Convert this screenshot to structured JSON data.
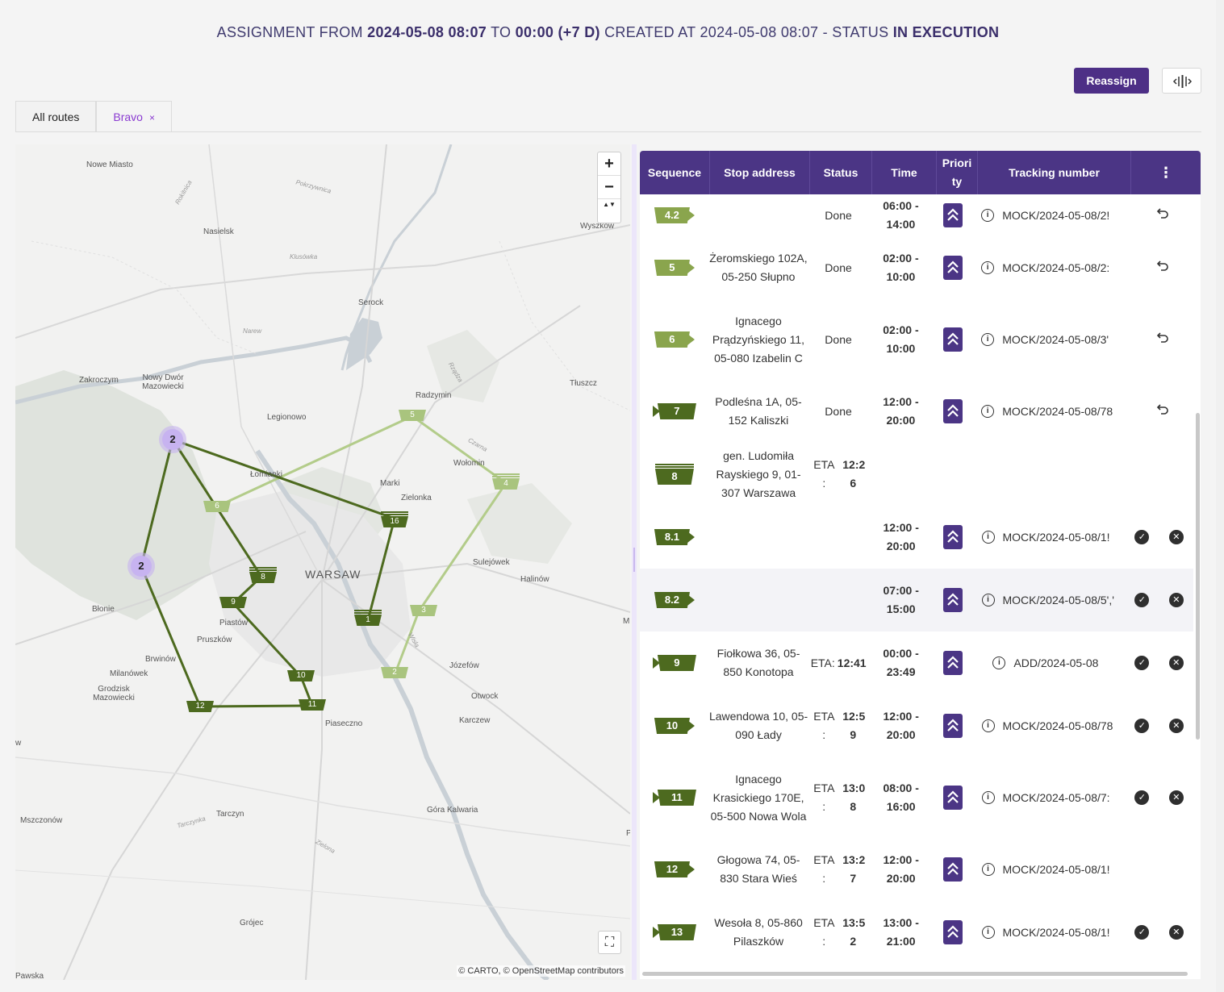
{
  "header": {
    "prefix": "ASSIGNMENT FROM",
    "from": "2024-05-08 08:07",
    "to_word": "TO",
    "to": "00:00 (+7 D)",
    "created_word": "CREATED AT 2024-05-08 08:07 - STATUS",
    "status": "IN EXECUTION"
  },
  "toolbar": {
    "reassign_label": "Reassign",
    "split_icon": "split-columns-icon"
  },
  "tabs": [
    {
      "label": "All routes"
    },
    {
      "label": "Bravo",
      "close": "×"
    }
  ],
  "map": {
    "zoom_in": "+",
    "zoom_out": "−",
    "compass": "▲▼",
    "fullscreen": "⛶",
    "attribution": "© CARTO, © OpenStreetMap contributors",
    "city_label": "WARSAW",
    "places": [
      "Nowe Miasto",
      "Nasielsk",
      "Wyszków",
      "Serock",
      "Zakroczym",
      "Nowy Dwór Mazowiecki",
      "Tłuszcz",
      "Radzymin",
      "Legionowo",
      "Łomianki",
      "Marki",
      "Wołomin",
      "Zielonka",
      "Sulejówek",
      "Halinów",
      "Błonie",
      "Piastów",
      "Pruszków",
      "Brwinów",
      "Milanówek",
      "Grodzisk Mazowiecki",
      "Józefów",
      "Otwock",
      "Karczew",
      "Piaseczno",
      "Tarczyn",
      "Mszczonów",
      "Góra Kalwaria",
      "Grójec",
      "Pawska",
      "M",
      "P",
      "w"
    ],
    "rivers": [
      "Pokrzywnica",
      "Klusówka",
      "Narew",
      "Rządza",
      "Czarna",
      "Wisła",
      "Tarczynka",
      "Zielona",
      "Rokitnica"
    ],
    "clusters": [
      "2",
      "2"
    ],
    "stops_dark": [
      "16",
      "8",
      "9",
      "1",
      "10",
      "11",
      "12"
    ],
    "stops_light": [
      "5",
      "6",
      "4",
      "3",
      "2"
    ]
  },
  "table": {
    "headers": [
      "Sequence",
      "Stop address",
      "Status",
      "Time",
      "Priori ty",
      "Tracking number"
    ],
    "menu_icon": "⋮",
    "rows": [
      {
        "seq": "4.2",
        "address": "",
        "status": "Done",
        "time": "06:00 - 14:00",
        "prio": "«",
        "tracking": "MOCK/2024-05-08/2!",
        "actions": "undo"
      },
      {
        "seq": "5",
        "address": "Żeromskiego 102A, 05-250 Słupno",
        "status": "Done",
        "time": "02:00 - 10:00",
        "prio": "«",
        "tracking": "MOCK/2024-05-08/2:",
        "actions": "undo"
      },
      {
        "seq": "6",
        "address": "Ignacego Prądzyńskiego 11, 05-080 Izabelin C",
        "status": "Done",
        "time": "02:00 - 10:00",
        "prio": "«",
        "tracking": "MOCK/2024-05-08/3'",
        "actions": "undo"
      },
      {
        "seq": "7",
        "address": "Podleśna 1A, 05-152 Kaliszki",
        "status": "Done",
        "time": "12:00 - 20:00",
        "prio": "«",
        "tracking": "MOCK/2024-05-08/78",
        "actions": "undo"
      },
      {
        "seq": "8",
        "address": "gen. Ludomiła Rayskiego 9, 01-307 Warszawa",
        "status": "ETA :",
        "eta": "12:2 6",
        "time": "",
        "prio": "",
        "tracking": "",
        "actions": ""
      },
      {
        "seq": "8.1",
        "address": "",
        "status": "",
        "time": "12:00 - 20:00",
        "prio": "«",
        "tracking": "MOCK/2024-05-08/1!",
        "actions": "okx"
      },
      {
        "seq": "8.2",
        "address": "",
        "status": "",
        "time": "07:00 - 15:00",
        "prio": "«",
        "tracking": "MOCK/2024-05-08/5','",
        "actions": "okx"
      },
      {
        "seq": "9",
        "address": "Fiołkowa 36, 05-850 Konotopa",
        "status": "ETA:",
        "eta": "12:41",
        "time": "00:00 - 23:49",
        "prio": "«",
        "tracking": "ADD/2024-05-08",
        "actions": "okx"
      },
      {
        "seq": "10",
        "address": "Lawendowa 10, 05-090 Łady",
        "status": "ETA :",
        "eta": "12:5 9",
        "time": "12:00 - 20:00",
        "prio": "«",
        "tracking": "MOCK/2024-05-08/78",
        "actions": "okx"
      },
      {
        "seq": "11",
        "address": "Ignacego Krasickiego 170E, 05-500 Nowa Wola",
        "status": "ETA :",
        "eta": "13:0 8",
        "time": "08:00 - 16:00",
        "prio": "«",
        "tracking": "MOCK/2024-05-08/7:",
        "actions": "okx"
      },
      {
        "seq": "12",
        "address": "Głogowa 74, 05-830 Stara Wieś",
        "status": "ETA :",
        "eta": "13:2 7",
        "time": "12:00 - 20:00",
        "prio": "«",
        "tracking": "MOCK/2024-05-08/1!",
        "actions": ""
      },
      {
        "seq": "13",
        "address": "Wesoła 8, 05-860 Pilaszków",
        "status": "ETA :",
        "eta": "13:5 2",
        "time": "13:00 - 21:00",
        "prio": "«",
        "tracking": "MOCK/2024-05-08/1!",
        "actions": "okx"
      }
    ]
  },
  "colors": {
    "accent": "#4b3585",
    "dark_route": "#4d6a1f",
    "light_route": "#a9c47e",
    "cluster": "#c7b3f0"
  }
}
